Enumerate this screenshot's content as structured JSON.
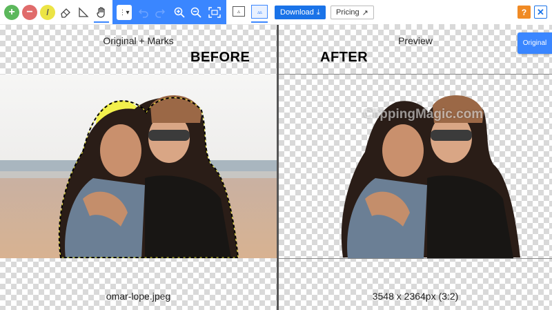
{
  "toolbar": {
    "tools": [
      {
        "name": "add-tool",
        "glyph": "+"
      },
      {
        "name": "remove-tool",
        "glyph": "−"
      },
      {
        "name": "hair-tool",
        "glyph": "/"
      }
    ],
    "menu_glyph": "⋮▾",
    "download_label": "Download",
    "download_glyph": "⤓",
    "pricing_label": "Pricing",
    "pricing_glyph": "↗",
    "view_single_glyph": "▵",
    "view_split_glyph": "▵▵"
  },
  "topright": {
    "help_label": "?",
    "close_label": "✕",
    "original_label": "Original"
  },
  "left_pane": {
    "title": "Original + Marks",
    "big_label": "BEFORE",
    "footer": "omar-lope.jpeg"
  },
  "right_pane": {
    "title": "Preview",
    "big_label": "AFTER",
    "watermark": "ClippingMagic.com",
    "footer": "3548 x 2364px (3:2)"
  },
  "colors": {
    "accent": "#3a86ff",
    "download": "#1a73e8",
    "help": "#f08a24",
    "mark_yellow": "#f2ef3a"
  }
}
